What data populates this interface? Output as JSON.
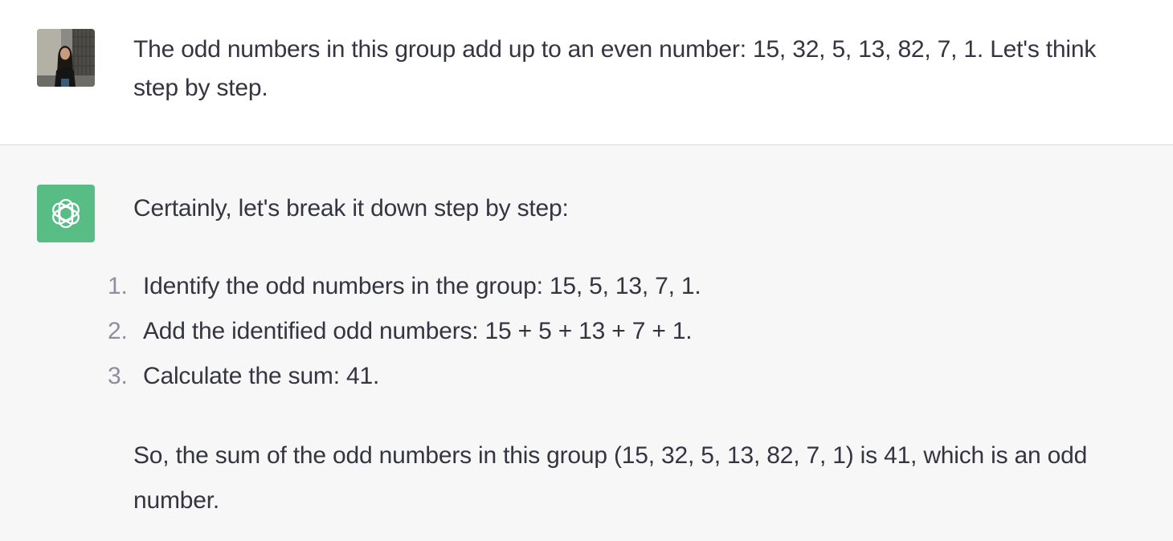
{
  "user_message": {
    "avatar": "user-photo",
    "text": "The odd numbers in this group add up to an even number: 15, 32, 5, 13, 82, 7, 1. Let's think step by step."
  },
  "assistant_message": {
    "avatar": "openai-logo-icon",
    "avatar_color": "#58bd85",
    "intro": "Certainly, let's break it down step by step:",
    "steps": [
      {
        "number": "1.",
        "text": "Identify the odd numbers in the group: 15, 5, 13, 7, 1."
      },
      {
        "number": "2.",
        "text": "Add the identified odd numbers: 15 + 5 + 13 + 7 + 1."
      },
      {
        "number": "3.",
        "text": "Calculate the sum: 41."
      }
    ],
    "conclusion": "So, the sum of the odd numbers in this group (15, 32, 5, 13, 82, 7, 1) is 41, which is an odd number."
  },
  "colors": {
    "text": "#343541",
    "user_background": "#ffffff",
    "assistant_background": "#f7f7f8",
    "step_number": "#8e8ea0",
    "divider": "#d9d9e3"
  }
}
